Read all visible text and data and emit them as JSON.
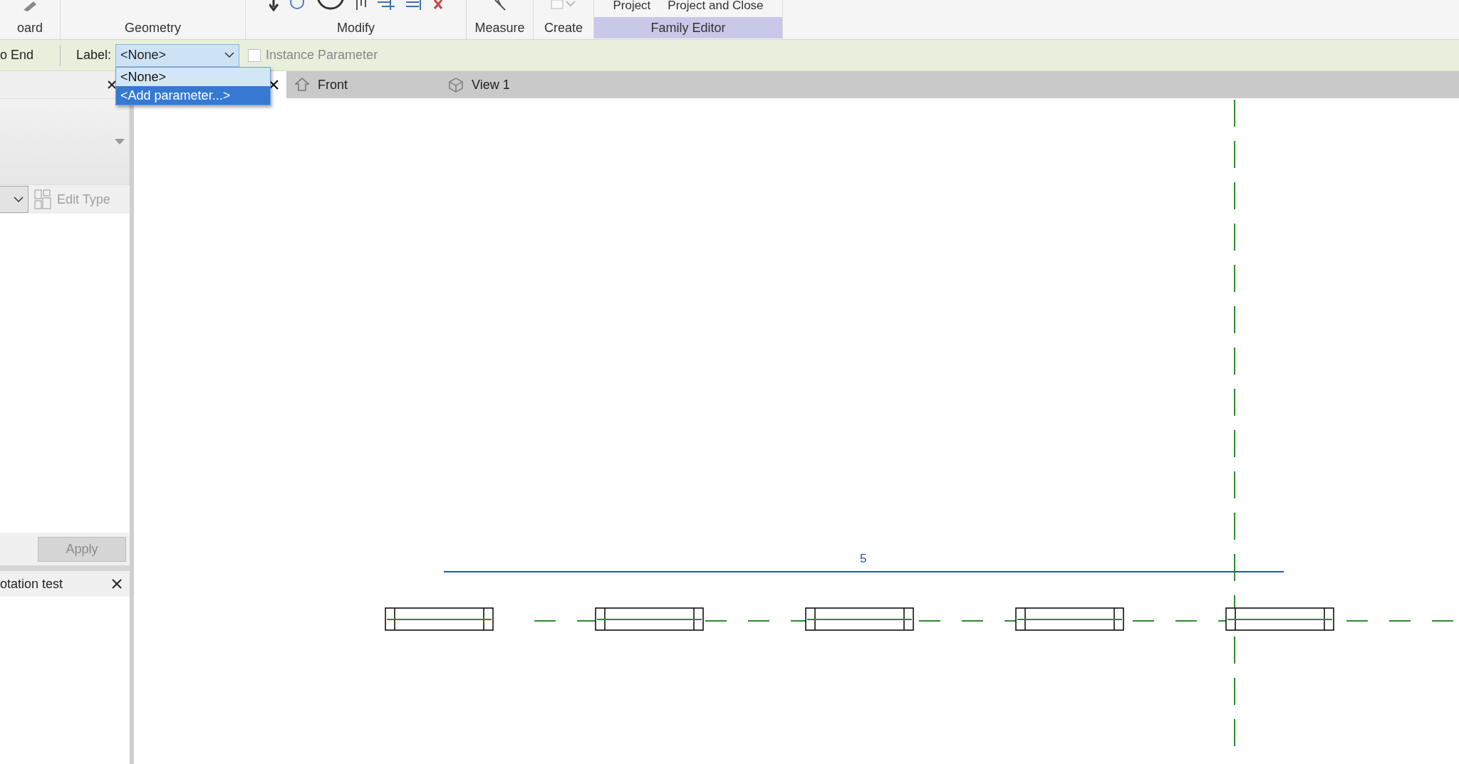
{
  "ribbon": {
    "top_texts": [
      "Project",
      "Project and Close"
    ],
    "panels": [
      {
        "label": "oard",
        "highlighted": false
      },
      {
        "label": "Geometry",
        "highlighted": false
      },
      {
        "label": "Modify",
        "highlighted": false
      },
      {
        "label": "Measure",
        "highlighted": false
      },
      {
        "label": "Create",
        "highlighted": false
      },
      {
        "label": "Family Editor",
        "highlighted": true
      }
    ]
  },
  "options_bar": {
    "left_text": "o End",
    "label": "Label:",
    "dropdown_value": "<None>",
    "dropdown_options": [
      {
        "label": "<None>",
        "selected": false
      },
      {
        "label": "<Add parameter...>",
        "selected": true
      }
    ],
    "checkbox": {
      "label": "Instance Parameter",
      "checked": false,
      "disabled": true
    }
  },
  "view_tabs": [
    {
      "label": "Front",
      "kind": "elevation",
      "selected": false
    },
    {
      "label": "View 1",
      "kind": "perspective",
      "selected": false
    }
  ],
  "properties": {
    "edit_type": "Edit Type",
    "apply": "Apply"
  },
  "second_panel": {
    "title": "otation test"
  },
  "drawing": {
    "dimension": "5"
  }
}
